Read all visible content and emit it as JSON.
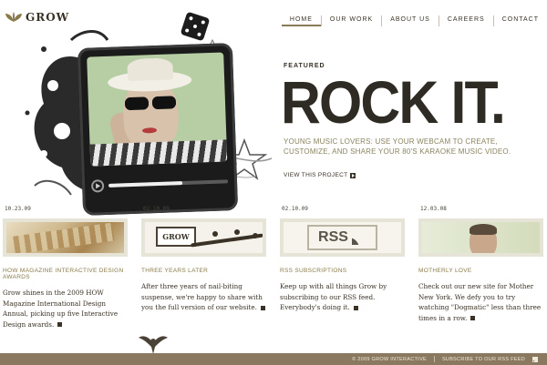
{
  "brand": {
    "name": "GROW"
  },
  "nav": {
    "items": [
      {
        "label": "HOME"
      },
      {
        "label": "OUR WORK"
      },
      {
        "label": "ABOUT US"
      },
      {
        "label": "CAREERS"
      },
      {
        "label": "CONTACT"
      }
    ]
  },
  "featured": {
    "label": "FEATURED",
    "headline": "ROCK IT.",
    "description": "YOUNG MUSIC LOVERS: USE YOUR WEBCAM TO CREATE, CUSTOMIZE, AND SHARE YOUR 80'S KARAOKE MUSIC VIDEO.",
    "link": "VIEW THIS PROJECT",
    "video_progress": 0.62
  },
  "posts": [
    {
      "date": "10.23.09",
      "title": "HOW MAGAZINE INTERACTIVE DESIGN AWARDS",
      "body": "Grow shines in the 2009 HOW Magazine International Design Annual, picking up five Interactive Design awards."
    },
    {
      "date": "02.10.09",
      "title": "THREE YEARS LATER",
      "body": "After three years of nail-biting suspense, we're happy to share with you the full version of our website.",
      "image_text": "GROW"
    },
    {
      "date": "02.10.09",
      "title": "RSS SUBSCRIPTIONS",
      "body": "Keep up with all things Grow by subscribing to our RSS feed. Everybody's doing it.",
      "image_text": "RSS"
    },
    {
      "date": "12.03.08",
      "title": "MOTHERLY LOVE",
      "body": "Check out our new site for Mother New York. We defy you to try watching \"Dogmatic\" less than three times in a row."
    }
  ],
  "footer": {
    "copyright": "© 2009 GROW INTERACTIVE",
    "rss": "SUBSCRIBE TO OUR RSS FEED"
  },
  "colors": {
    "accent": "#8a7a48",
    "footer_bg": "#8a7860",
    "text": "#3a3226"
  }
}
